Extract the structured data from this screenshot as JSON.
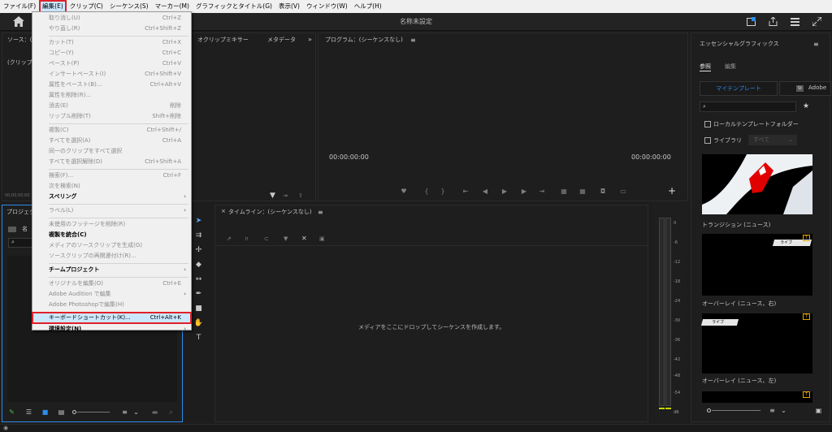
{
  "menubar": {
    "items": [
      "ファイル(F)",
      "編集(E)",
      "クリップ(C)",
      "シーケンス(S)",
      "マーカー(M)",
      "グラフィックとタイトル(G)",
      "表示(V)",
      "ウィンドウ(W)",
      "ヘルプ(H)"
    ]
  },
  "header": {
    "title": "名称未設定"
  },
  "edit_menu": {
    "items": [
      {
        "label": "取り消し(U)",
        "shortcut": "Ctrl+Z",
        "disabled": true
      },
      {
        "label": "やり直し(R)",
        "shortcut": "Ctrl+Shift+Z",
        "disabled": true
      },
      {
        "label": "カット(T)",
        "shortcut": "Ctrl+X",
        "disabled": true
      },
      {
        "label": "コピー(Y)",
        "shortcut": "Ctrl+C",
        "disabled": true
      },
      {
        "label": "ペースト(P)",
        "shortcut": "Ctrl+V",
        "disabled": true
      },
      {
        "label": "インサートペースト(I)",
        "shortcut": "Ctrl+Shift+V",
        "disabled": true
      },
      {
        "label": "属性をペースト(B)...",
        "shortcut": "Ctrl+Alt+V",
        "disabled": true
      },
      {
        "label": "属性を削除(R)...",
        "shortcut": "",
        "disabled": true
      },
      {
        "label": "消去(E)",
        "shortcut": "削除",
        "disabled": true
      },
      {
        "label": "リップル削除(T)",
        "shortcut": "Shift+削除",
        "disabled": true
      },
      {
        "label": "複製(C)",
        "shortcut": "Ctrl+Shift+/",
        "disabled": true
      },
      {
        "label": "すべてを選択(A)",
        "shortcut": "Ctrl+A",
        "disabled": true
      },
      {
        "label": "同一のクリップをすべて選択",
        "shortcut": "",
        "disabled": true
      },
      {
        "label": "すべてを選択解除(D)",
        "shortcut": "Ctrl+Shift+A",
        "disabled": true
      },
      {
        "label": "検索(F)...",
        "shortcut": "Ctrl+F",
        "disabled": true
      },
      {
        "label": "次を検索(N)",
        "shortcut": "",
        "disabled": true
      },
      {
        "label": "スペリング",
        "shortcut": "",
        "disabled": false,
        "bold": true,
        "submenu": true
      },
      {
        "label": "ラベル(L)",
        "shortcut": "",
        "disabled": true,
        "submenu": true
      },
      {
        "label": "未使用のフッテージを削除(R)",
        "shortcut": "",
        "disabled": true
      },
      {
        "label": "複製を統合(C)",
        "shortcut": "",
        "disabled": false,
        "bold": true
      },
      {
        "label": "メディアのソースクリップを生成(G)",
        "shortcut": "",
        "disabled": true
      },
      {
        "label": "ソースクリップの再関連付け(R)...",
        "shortcut": "",
        "disabled": true
      },
      {
        "label": "チームプロジェクト",
        "shortcut": "",
        "disabled": false,
        "bold": true,
        "submenu": true
      },
      {
        "label": "オリジナルを編集(O)",
        "shortcut": "Ctrl+E",
        "disabled": true
      },
      {
        "label": "Adobe Audition で編集",
        "shortcut": "",
        "disabled": true,
        "submenu": true
      },
      {
        "label": "Adobe Photoshopで編集(H)",
        "shortcut": "",
        "disabled": true
      },
      {
        "label": "キーボードショートカット(K)...",
        "shortcut": "Ctrl+Alt+K",
        "disabled": false,
        "highlight": true
      },
      {
        "label": "環境設定(N)",
        "shortcut": "",
        "disabled": false,
        "bold": true,
        "submenu": true
      }
    ]
  },
  "source_panel": {
    "tab_source": "ソース：(",
    "tab_audio": "オクリップミキサー",
    "tab_meta": "メタデータ",
    "clip_label": "(クリップ",
    "timecode": "00;00;00;00"
  },
  "program_panel": {
    "title": "プログラム：(シーケンスなし)",
    "tc_left": "00:00:00:00",
    "tc_right": "00:00:00:00"
  },
  "project_panel": {
    "tab": "プロジェク",
    "name_label": "名",
    "search_value": ""
  },
  "timeline_panel": {
    "title": "タイムライン：(シーケンスなし)",
    "drop_message": "メディアをここにドロップしてシーケンスを作成します。"
  },
  "meter": {
    "labels": [
      "0",
      "-6",
      "-12",
      "-18",
      "-24",
      "-30",
      "-36",
      "-42",
      "-48",
      "-54",
      "dB"
    ]
  },
  "essential_graphics": {
    "title": "エッセンシャルグラフィックス",
    "tab_browse": "参照",
    "tab_edit": "編集",
    "btn_my_templates": "マイテンプレート",
    "btn_adobe": "Adobe",
    "checkbox_local": "ローカルテンプレートフォルダー",
    "checkbox_library": "ライブラリ",
    "library_select": "すべて",
    "templates": [
      {
        "label": "トランジション (ニュース)"
      },
      {
        "label": "オーバーレイ (ニュース、右)",
        "tag": "ライブ"
      },
      {
        "label": "オーバーレイ (ニュース、左)",
        "tag": "ライブ"
      }
    ]
  },
  "colors": {
    "accent": "#2d8ceb",
    "highlight_red": "#e0202a",
    "badge": "#e4a500"
  }
}
